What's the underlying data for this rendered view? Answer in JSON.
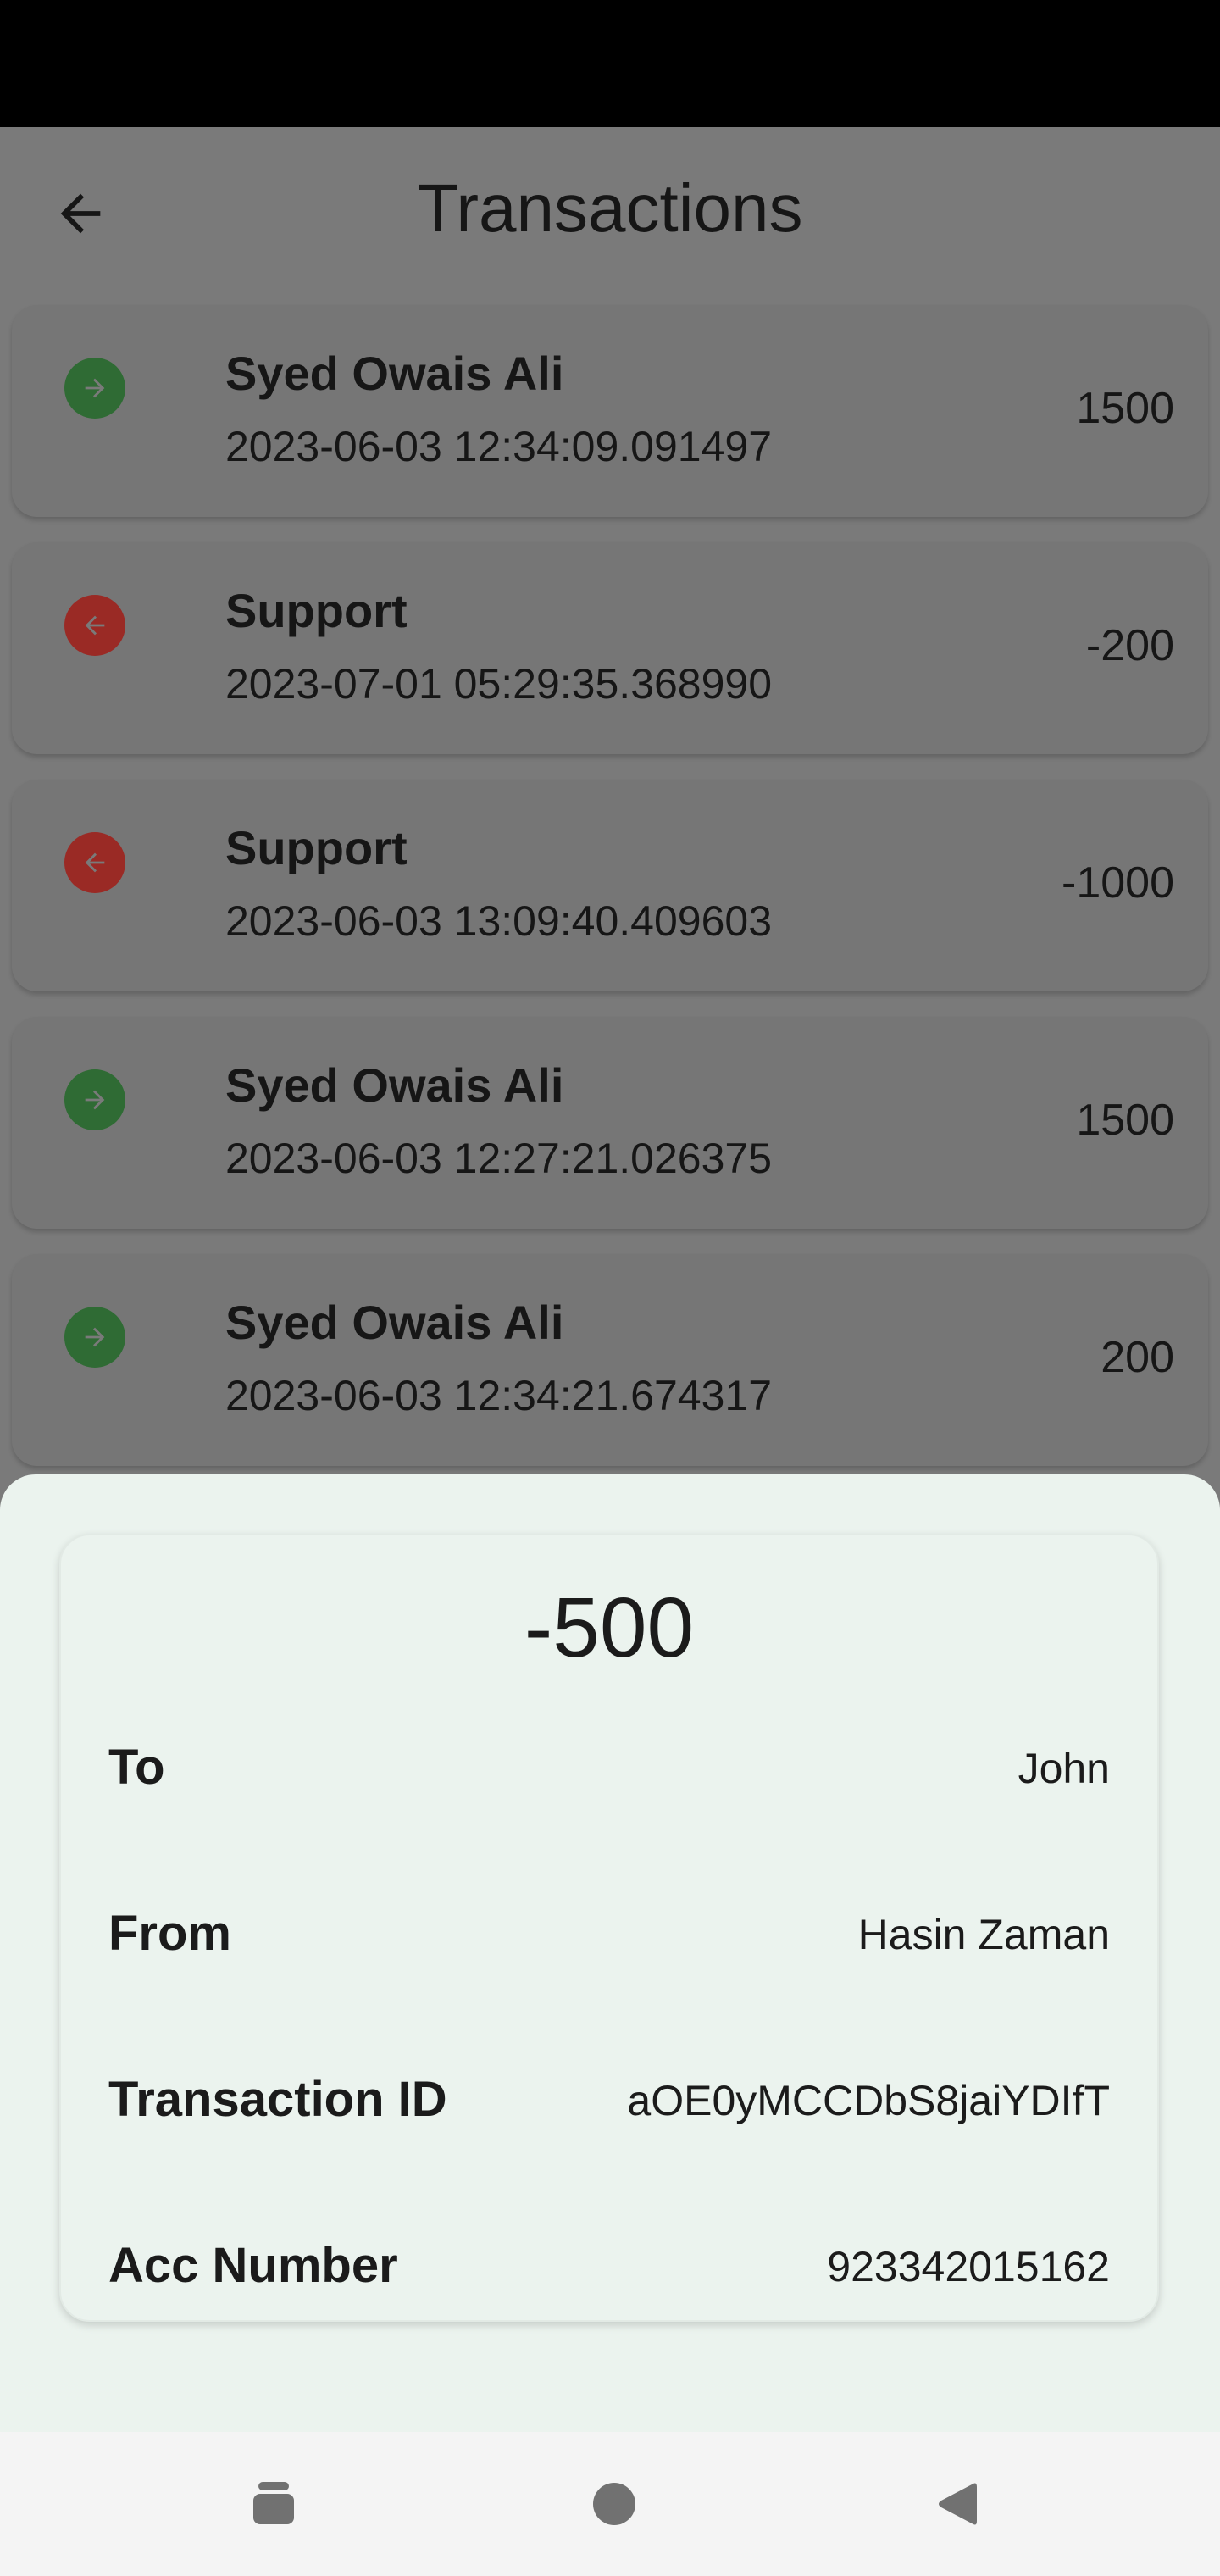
{
  "header": {
    "title": "Transactions"
  },
  "transactions": [
    {
      "name": "Syed Owais Ali",
      "date": "2023-06-03 12:34:09.091497",
      "amount": "1500",
      "direction": "incoming"
    },
    {
      "name": "Support",
      "date": "2023-07-01 05:29:35.368990",
      "amount": "-200",
      "direction": "outgoing"
    },
    {
      "name": "Support",
      "date": "2023-06-03 13:09:40.409603",
      "amount": "-1000",
      "direction": "outgoing"
    },
    {
      "name": "Syed Owais Ali",
      "date": "2023-06-03 12:27:21.026375",
      "amount": "1500",
      "direction": "incoming"
    },
    {
      "name": "Syed Owais Ali",
      "date": "2023-06-03 12:34:21.674317",
      "amount": "200",
      "direction": "incoming"
    }
  ],
  "detail": {
    "amount": "-500",
    "rows": [
      {
        "label": "To",
        "value": "John"
      },
      {
        "label": "From",
        "value": "Hasin Zaman"
      },
      {
        "label": "Transaction ID",
        "value": "aOE0yMCCDbS8jaiYDIfT"
      },
      {
        "label": "Acc Number",
        "value": "923342015162"
      }
    ]
  },
  "icons": {
    "back": "arrow-left-icon",
    "incoming": "arrow-right-icon",
    "outgoing": "arrow-left-icon",
    "nav_recents": "recents-icon",
    "nav_home": "home-icon",
    "nav_back": "back-triangle-icon"
  },
  "colors": {
    "incoming": "#2f6b34",
    "outgoing": "#9a2a25",
    "sheet_background": "#ebf3ee"
  }
}
